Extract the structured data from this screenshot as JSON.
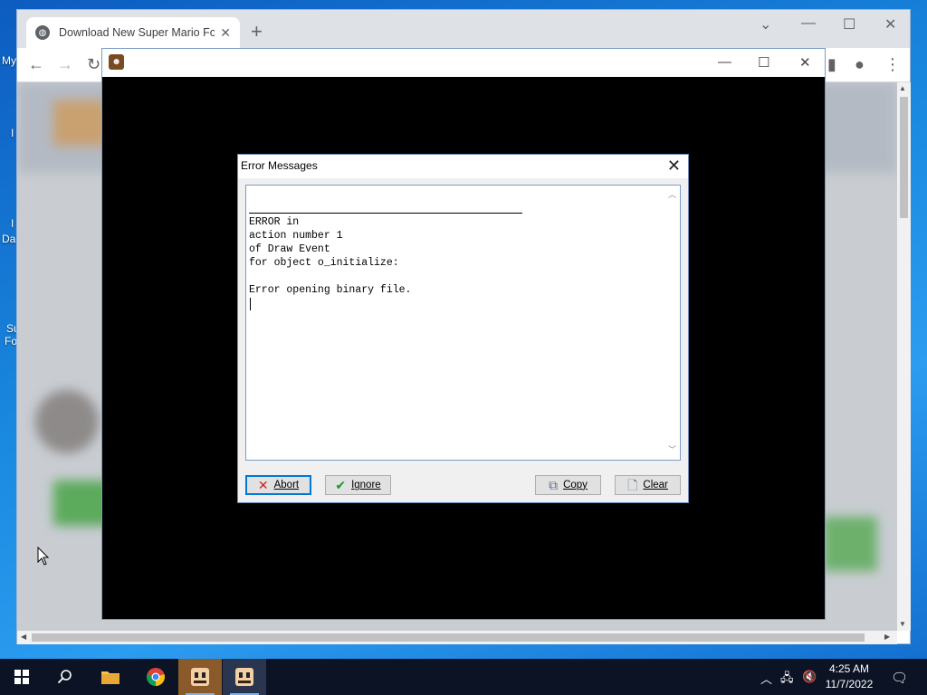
{
  "desktop": {
    "fragments": [
      "My",
      "I",
      "I",
      "Da",
      "Su",
      "Fo"
    ]
  },
  "browser": {
    "tab_title": "Download New Super Mario Fore",
    "tab_close": "✕",
    "new_tab": "+",
    "window_controls": {
      "collapse": "⌄",
      "minimize": "—",
      "maximize": "☐",
      "close": "✕"
    },
    "toolbar_icons": {
      "back": "←",
      "forward": "→",
      "reload": "↻",
      "side_panel": "▮",
      "profile": "●",
      "menu": "⋮"
    }
  },
  "game_window": {
    "window_controls": {
      "minimize": "—",
      "maximize": "☐",
      "close": "✕"
    }
  },
  "dialog": {
    "title": "Error Messages",
    "close": "✕",
    "lines": [
      "ERROR in",
      "action number 1",
      "of Draw Event",
      "for object o_initialize:",
      "",
      "Error opening binary file."
    ],
    "buttons": {
      "abort": "Abort",
      "ignore": "Ignore",
      "copy": "Copy",
      "clear": "Clear"
    }
  },
  "taskbar": {
    "time": "4:25 AM",
    "date": "11/7/2022"
  },
  "colors": {
    "accent": "#0078d7",
    "abort_icon": "#d02020",
    "ignore_icon": "#1a9a2a",
    "taskbar": "#0c1324"
  }
}
